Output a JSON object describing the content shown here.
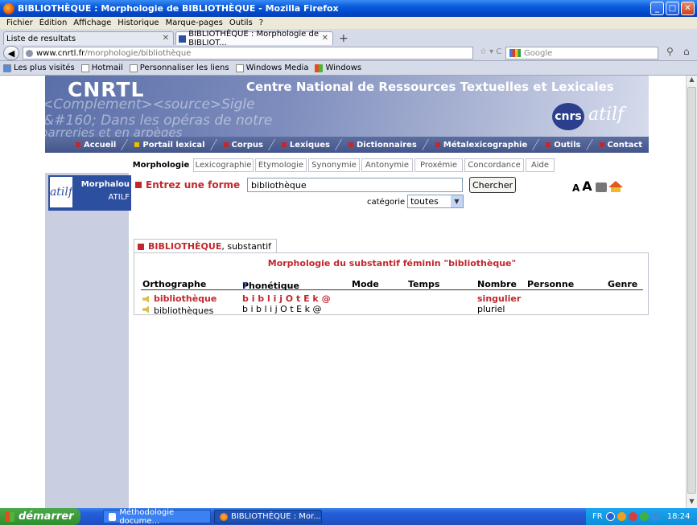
{
  "window": {
    "title": "BIBLIOTHÈQUE : Morphologie de BIBLIOTHÈQUE - Mozilla Firefox"
  },
  "menu": [
    "Fichier",
    "Édition",
    "Affichage",
    "Historique",
    "Marque-pages",
    "Outils",
    "?"
  ],
  "tabs": [
    {
      "label": "Liste de resultats",
      "active": false
    },
    {
      "label": "BIBLIOTHÈQUE : Morphologie de BIBLIOT...",
      "active": true
    }
  ],
  "url": {
    "host": "www.cnrtl.fr",
    "path": "/morphologie/bibliothèque"
  },
  "search_engine": {
    "placeholder": "Google"
  },
  "bookmarks": [
    "Les plus visités",
    "Hotmail",
    "Personnaliser les liens",
    "Windows Media",
    "Windows"
  ],
  "site": {
    "logo": "CNRTL",
    "subtitle": "Centre National de Ressources Textuelles et Lexicales",
    "partner1": "cnrs",
    "partner2": "atilf",
    "main_nav": [
      {
        "label": "Accueil",
        "active": false
      },
      {
        "label": "Portail lexical",
        "active": true
      },
      {
        "label": "Corpus",
        "active": false
      },
      {
        "label": "Lexiques",
        "active": false
      },
      {
        "label": "Dictionnaires",
        "active": false
      },
      {
        "label": "Métalexicographie",
        "active": false
      },
      {
        "label": "Outils",
        "active": false
      },
      {
        "label": "Contact",
        "active": false
      }
    ],
    "sub_tabs": [
      "Morphologie",
      "Lexicographie",
      "Etymologie",
      "Synonymie",
      "Antonymie",
      "Proxémie",
      "Concordance",
      "Aide"
    ],
    "active_sub_tab": "Morphologie"
  },
  "sidebar": {
    "logo": "atilf",
    "title": "Morphalou",
    "subtitle": "ATILF"
  },
  "form": {
    "label": "Entrez une forme",
    "value": "bibliothèque",
    "submit": "Chercher",
    "category_label": "catégorie :",
    "category_value": "toutes"
  },
  "result": {
    "tab_head": "BIBLIOTHÈQUE",
    "tab_tail": ", substantif",
    "title": "Morphologie du substantif féminin \"bibliothèque\"",
    "columns": [
      "Orthographe",
      "Phonétique",
      "Mode",
      "Temps",
      "Nombre",
      "Personne",
      "Genre"
    ],
    "help_mark": "?",
    "rows": [
      {
        "orthographe": "bibliothèque",
        "phonetique": "b i b l i j O t E k @",
        "nombre": "singulier"
      },
      {
        "orthographe": "bibliothèques",
        "phonetique": "b i b l i j O t E k @",
        "nombre": "pluriel"
      }
    ]
  },
  "taskbar": {
    "start": "démarrer",
    "items": [
      "Méthodologie docume...",
      "BIBLIOTHÈQUE : Mor..."
    ],
    "lang": "FR",
    "clock": "18:24"
  }
}
